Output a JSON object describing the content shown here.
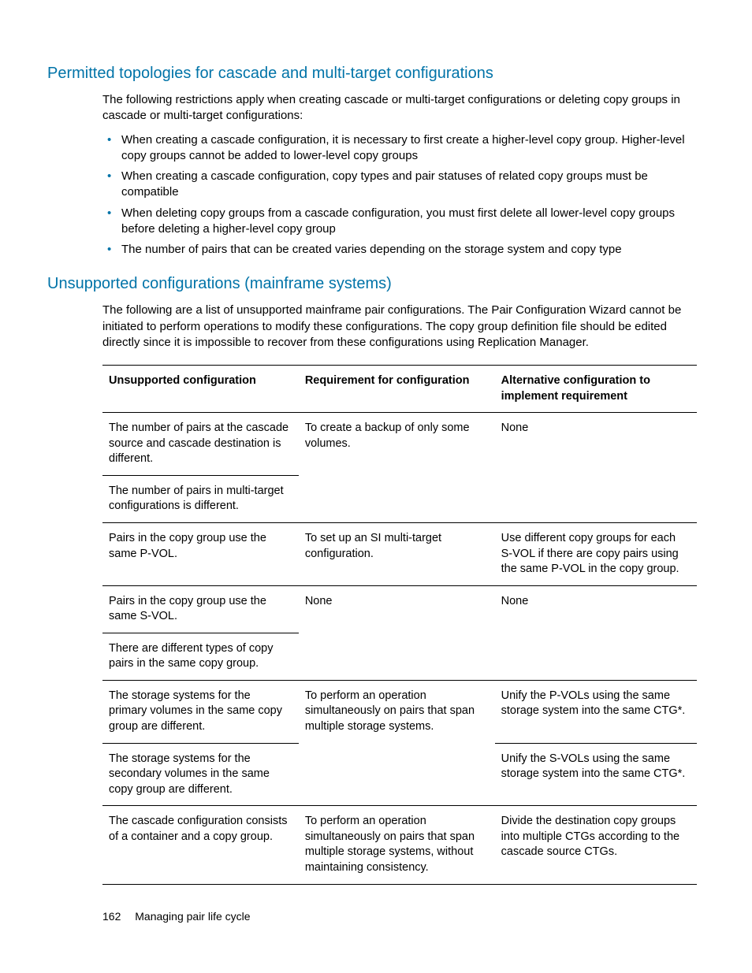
{
  "section1": {
    "heading": "Permitted topologies for cascade and multi-target configurations",
    "intro": "The following restrictions apply when creating cascade or multi-target configurations or deleting copy groups in cascade or multi-target configurations:",
    "bullets": [
      "When creating a cascade configuration, it is necessary to first create a higher-level copy group. Higher-level copy groups cannot be added to lower-level copy groups",
      "When creating a cascade configuration, copy types and pair statuses of related copy groups must be compatible",
      "When deleting copy groups from a cascade configuration, you must first delete all lower-level copy groups before deleting a higher-level copy group",
      "The number of pairs that can be created varies depending on the storage system and copy type"
    ]
  },
  "section2": {
    "heading": "Unsupported configurations (mainframe systems)",
    "intro": "The following are a list of unsupported mainframe pair configurations. The Pair Configuration Wizard cannot be initiated to perform operations to modify these configurations. The copy group definition file should be edited directly since it is impossible to recover from these configurations using Replication Manager."
  },
  "table": {
    "headers": {
      "c1": "Unsupported configuration",
      "c2": "Requirement for configuration",
      "c3": "Alternative configuration to implement requirement"
    },
    "rows": {
      "r1c1": "The number of pairs at the cascade source and cascade destination is different.",
      "r2c1": "The number of pairs in multi-target configurations is different.",
      "r12c2": "To create a backup of only some volumes.",
      "r12c3": "None",
      "r3c1": "Pairs in the copy group use the same P-VOL.",
      "r3c2": "To set up an SI  multi-target configuration.",
      "r3c3": "Use different copy groups for each S-VOL if there are copy pairs using the same P-VOL in the copy group.",
      "r4c1": "Pairs in the copy group use the same S-VOL.",
      "r5c1": "There are different types of copy pairs in the same copy group.",
      "r45c2": "None",
      "r45c3": "None",
      "r6c1": "The storage systems for the primary volumes in the same copy group are different.",
      "r7c1": "The storage systems for the secondary volumes in the same copy group are different.",
      "r67c2": "To perform an operation simultaneously on pairs that span multiple storage systems.",
      "r6c3": "Unify the P-VOLs using the same storage system into the same CTG*.",
      "r7c3": "Unify the S-VOLs using the same storage system into the same CTG*.",
      "r8c1": "The cascade configuration consists of a container and a copy group.",
      "r8c2": "To perform an operation simultaneously on pairs that span multiple storage systems, without maintaining consistency.",
      "r8c3": "Divide the destination copy groups into multiple CTGs according to the cascade source CTGs."
    }
  },
  "footer": {
    "page": "162",
    "title": "Managing pair life cycle"
  }
}
